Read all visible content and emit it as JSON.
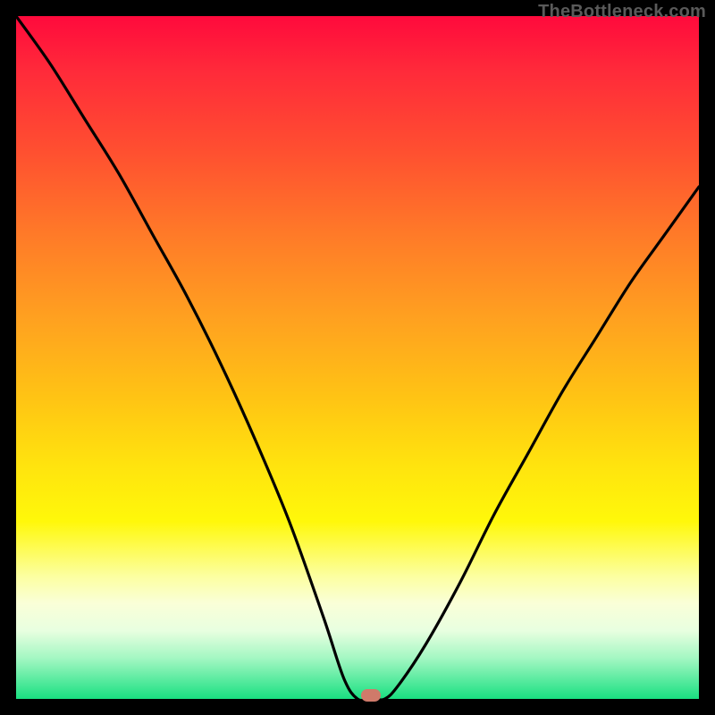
{
  "watermark": "TheBottleneck.com",
  "colors": {
    "frame": "#000000",
    "curve": "#000000",
    "marker": "#cf7a6a"
  },
  "chart_data": {
    "type": "line",
    "title": "",
    "xlabel": "",
    "ylabel": "",
    "xlim": [
      0,
      100
    ],
    "ylim": [
      0,
      100
    ],
    "series": [
      {
        "name": "bottleneck-curve",
        "x": [
          0,
          5,
          10,
          15,
          20,
          25,
          30,
          35,
          40,
          45,
          48,
          50,
          52,
          54,
          56,
          60,
          65,
          70,
          75,
          80,
          85,
          90,
          95,
          100
        ],
        "y": [
          100,
          93,
          85,
          77,
          68,
          59,
          49,
          38,
          26,
          12,
          3,
          0,
          0,
          0,
          2,
          8,
          17,
          27,
          36,
          45,
          53,
          61,
          68,
          75
        ]
      }
    ],
    "annotations": [
      {
        "name": "optimal-marker",
        "x": 52,
        "y": 0.5
      }
    ],
    "background_gradient": [
      "#ff0a3c",
      "#ffe40e",
      "#19e081"
    ]
  }
}
